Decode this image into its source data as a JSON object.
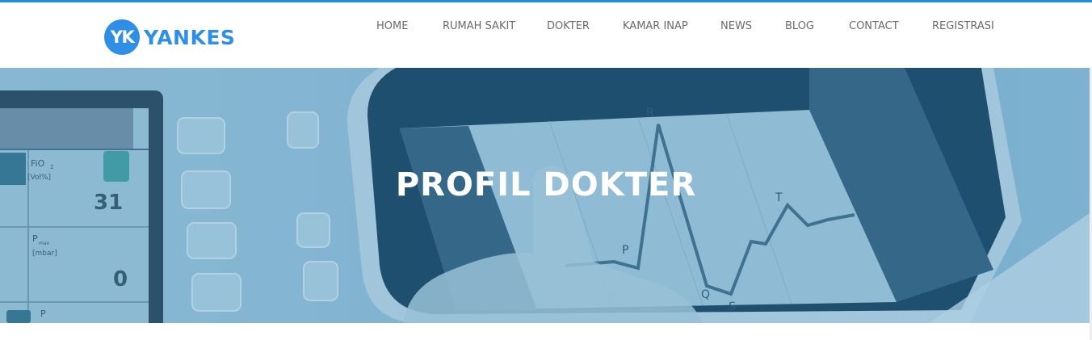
{
  "brand": {
    "badge": "YK",
    "name": "YANKES",
    "color": "#2f8fe6"
  },
  "theme": {
    "top_stripe": "#1e8fd6",
    "nav_text": "#6a6a6a",
    "hero_overlay": "#7fb3d0"
  },
  "nav": {
    "items": [
      {
        "label": "HOME"
      },
      {
        "label": "RUMAH SAKIT"
      },
      {
        "label": "DOKTER"
      },
      {
        "label": "KAMAR INAP"
      },
      {
        "label": "NEWS"
      },
      {
        "label": "BLOG"
      },
      {
        "label": "CONTACT"
      },
      {
        "label": "REGISTRASI"
      }
    ]
  },
  "hero": {
    "title": "PROFIL DOKTER",
    "monitor_labels": {
      "fio2": "FiO",
      "fio2_sub": "2",
      "fio2_unit": "[Vol%]",
      "value_1": "31",
      "value_2": "0",
      "p_max": "P",
      "p_max_sub": "max",
      "p_unit": "[mbar]",
      "p_plat": "P"
    },
    "ecg_labels": {
      "r": "R",
      "t": "T",
      "q": "Q",
      "s": "S",
      "p": "P"
    }
  }
}
